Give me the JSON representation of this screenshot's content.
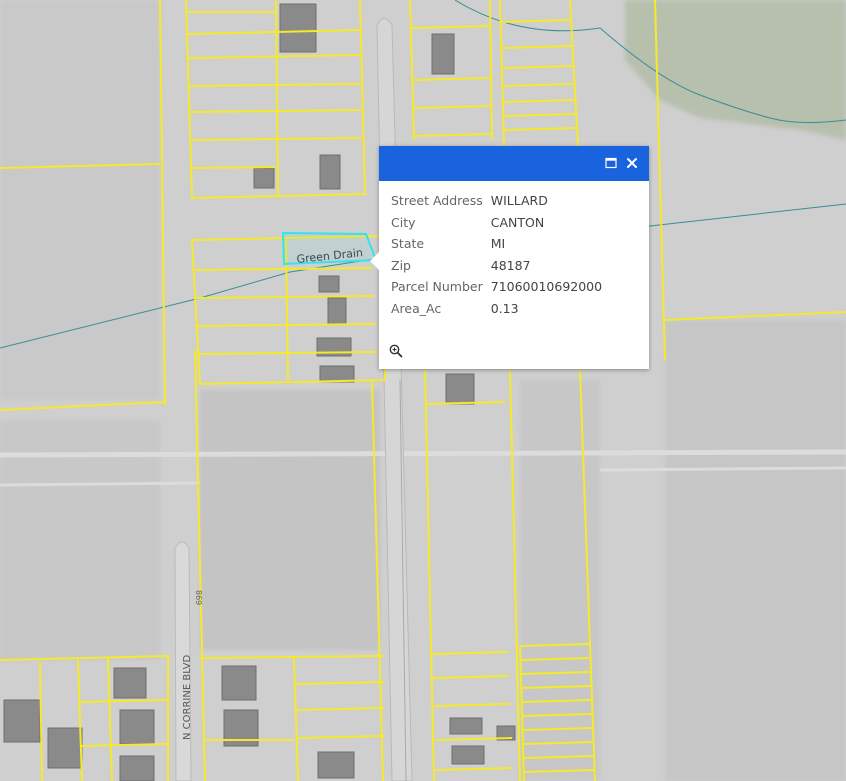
{
  "map": {
    "labels": {
      "drain": "Green Drain",
      "road": "N CORRINE BLVD",
      "road_number": "869"
    },
    "colors": {
      "parcel_line": "#f4ea2b",
      "highlight": "#35e3ee",
      "water": "#3a8d94",
      "ground": "#cfcfcf"
    }
  },
  "popup": {
    "header_color": "#1a63df",
    "maximize_icon": "maximize-icon",
    "close_icon": "close-icon",
    "zoom_icon": "zoom-to-icon",
    "fields": [
      {
        "key": "Street Address",
        "value": "WILLARD"
      },
      {
        "key": "City",
        "value": "CANTON"
      },
      {
        "key": "State",
        "value": "MI"
      },
      {
        "key": "Zip",
        "value": "48187"
      },
      {
        "key": "Parcel Number",
        "value": "71060010692000"
      },
      {
        "key": "Area_Ac",
        "value": "0.13"
      }
    ]
  }
}
